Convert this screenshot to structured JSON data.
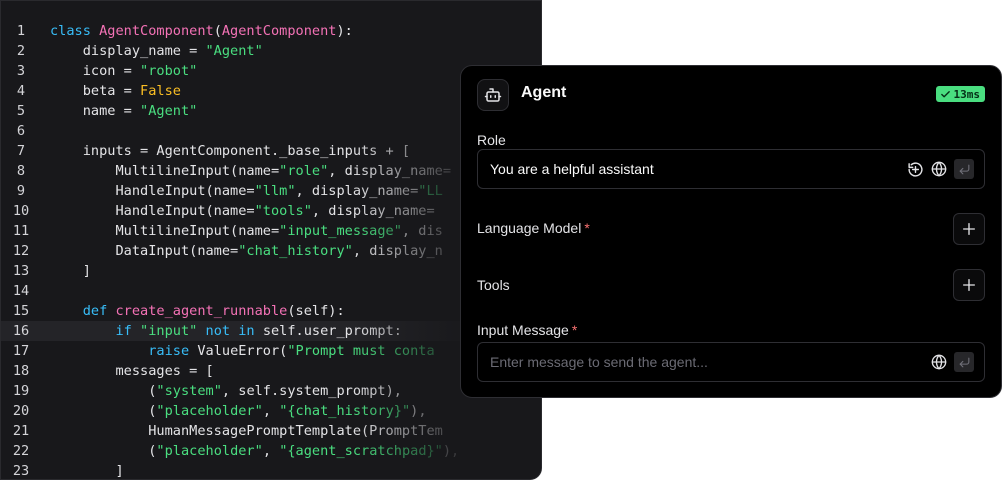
{
  "code": {
    "lines": [
      {
        "n": "1",
        "t": [
          [
            "kw",
            "class "
          ],
          [
            "fn",
            "AgentComponent"
          ],
          [
            "",
            "("
          ],
          [
            "fn",
            "AgentComponent"
          ],
          [
            "",
            "):"
          ]
        ]
      },
      {
        "n": "2",
        "t": [
          [
            "",
            "    display_name = "
          ],
          [
            "str",
            "\"Agent\""
          ]
        ]
      },
      {
        "n": "3",
        "t": [
          [
            "",
            "    icon = "
          ],
          [
            "str",
            "\"robot\""
          ]
        ]
      },
      {
        "n": "4",
        "t": [
          [
            "",
            "    beta = "
          ],
          [
            "bool",
            "False"
          ]
        ]
      },
      {
        "n": "5",
        "t": [
          [
            "",
            "    name = "
          ],
          [
            "str",
            "\"Agent\""
          ]
        ]
      },
      {
        "n": "6",
        "t": []
      },
      {
        "n": "7",
        "t": [
          [
            "",
            "    inputs = AgentComponent._base_inputs + ["
          ]
        ]
      },
      {
        "n": "8",
        "t": [
          [
            "",
            "        MultilineInput(name="
          ],
          [
            "str",
            "\"role\""
          ],
          [
            "",
            ", display_name="
          ]
        ]
      },
      {
        "n": "9",
        "t": [
          [
            "",
            "        HandleInput(name="
          ],
          [
            "str",
            "\"llm\""
          ],
          [
            "",
            ", display_name="
          ],
          [
            "str",
            "\"LL"
          ]
        ]
      },
      {
        "n": "10",
        "t": [
          [
            "",
            "        HandleInput(name="
          ],
          [
            "str",
            "\"tools\""
          ],
          [
            "",
            ", display_name="
          ]
        ]
      },
      {
        "n": "11",
        "t": [
          [
            "",
            "        MultilineInput(name="
          ],
          [
            "str",
            "\"input_message\""
          ],
          [
            "",
            ", dis"
          ]
        ]
      },
      {
        "n": "12",
        "t": [
          [
            "",
            "        DataInput(name="
          ],
          [
            "str",
            "\"chat_history\""
          ],
          [
            "",
            ", display_n"
          ]
        ]
      },
      {
        "n": "13",
        "t": [
          [
            "",
            "    ]"
          ]
        ]
      },
      {
        "n": "14",
        "t": []
      },
      {
        "n": "15",
        "t": [
          [
            "kw",
            "    def "
          ],
          [
            "fn",
            "create_agent_runnable"
          ],
          [
            "",
            "(self):"
          ]
        ]
      },
      {
        "n": "16",
        "t": [
          [
            "kw",
            "        if "
          ],
          [
            "str",
            "\"input\" "
          ],
          [
            "kw",
            "not in "
          ],
          [
            "",
            "self.user_prompt:"
          ]
        ],
        "active": true
      },
      {
        "n": "17",
        "t": [
          [
            "kw",
            "            raise "
          ],
          [
            "",
            "ValueError("
          ],
          [
            "str",
            "\"Prompt must conta"
          ]
        ]
      },
      {
        "n": "18",
        "t": [
          [
            "",
            "        messages = ["
          ]
        ]
      },
      {
        "n": "19",
        "t": [
          [
            "",
            "            ("
          ],
          [
            "str",
            "\"system\""
          ],
          [
            "",
            ", self.system_prompt),"
          ]
        ]
      },
      {
        "n": "20",
        "t": [
          [
            "",
            "            ("
          ],
          [
            "str",
            "\"placeholder\""
          ],
          [
            "",
            ", "
          ],
          [
            "str",
            "\"{chat_history}\""
          ],
          [
            "",
            "),"
          ]
        ]
      },
      {
        "n": "21",
        "t": [
          [
            "",
            "            HumanMessagePromptTemplate(PromptTem"
          ]
        ]
      },
      {
        "n": "22",
        "t": [
          [
            "",
            "            ("
          ],
          [
            "str",
            "\"placeholder\""
          ],
          [
            "",
            ", "
          ],
          [
            "str",
            "\"{agent_scratchpad}\""
          ],
          [
            "",
            "),"
          ]
        ]
      },
      {
        "n": "23",
        "t": [
          [
            "",
            "        ]"
          ]
        ]
      }
    ]
  },
  "panel": {
    "title": "Agent",
    "icon": "robot-icon",
    "badge": "13ms",
    "role_label": "Role",
    "role_value": "You are a helpful assistant",
    "language_model_label": "Language Model",
    "tools_label": "Tools",
    "input_message_label": "Input Message",
    "input_message_placeholder": "Enter message to send the agent...",
    "required_mark": "*"
  },
  "colors": {
    "accent_green": "#4ade80",
    "required_red": "#f87171",
    "keyword": "#38bdf8",
    "function": "#f472b6",
    "string": "#4ade80",
    "boolean": "#fbbf24"
  }
}
